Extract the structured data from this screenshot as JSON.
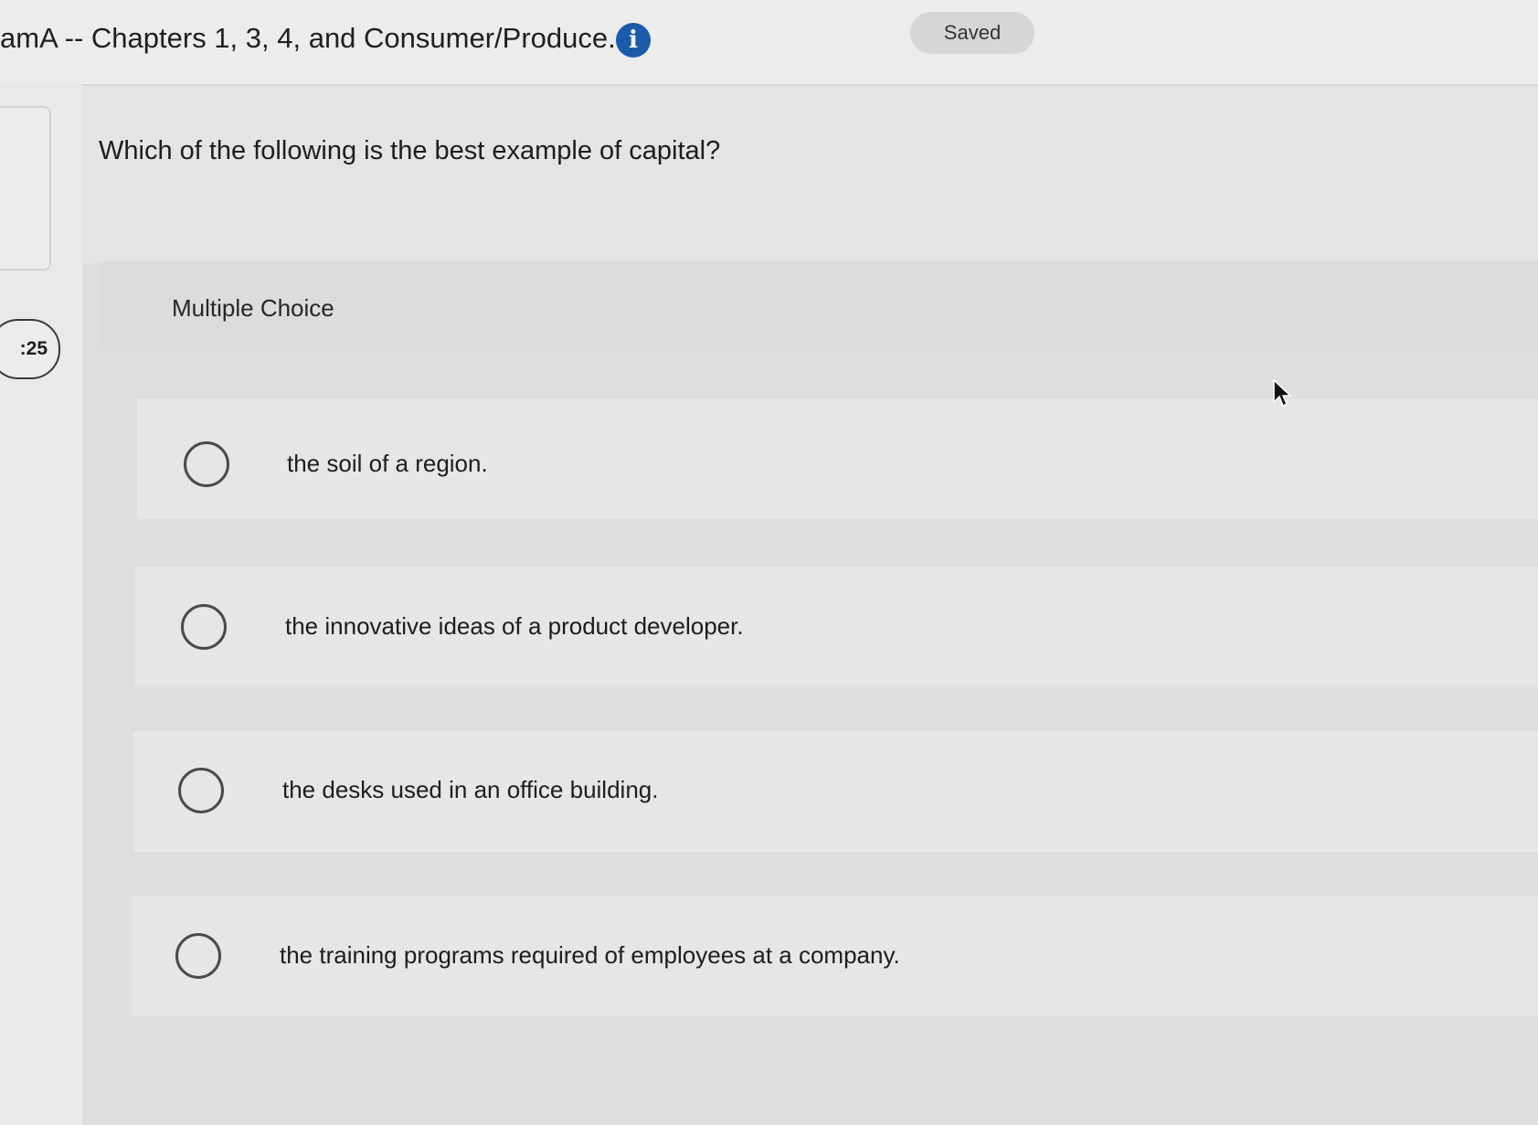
{
  "header": {
    "title": "amA -- Chapters 1, 3, 4, and Consumer/Produce...",
    "info_icon": "info-icon",
    "saved_label": "Saved"
  },
  "sidebar": {
    "timer": ":25"
  },
  "question": {
    "text": "Which of the following is the best example of capital?",
    "type_label": "Multiple Choice",
    "options": [
      {
        "label": "the soil of a region.",
        "selected": false
      },
      {
        "label": "the innovative ideas of a product developer.",
        "selected": false
      },
      {
        "label": "the desks used in an office building.",
        "selected": false
      },
      {
        "label": "the training programs required of employees at a company.",
        "selected": false
      }
    ]
  },
  "colors": {
    "info_icon_bg": "#1a5cab",
    "background": "#e4e4e4"
  }
}
